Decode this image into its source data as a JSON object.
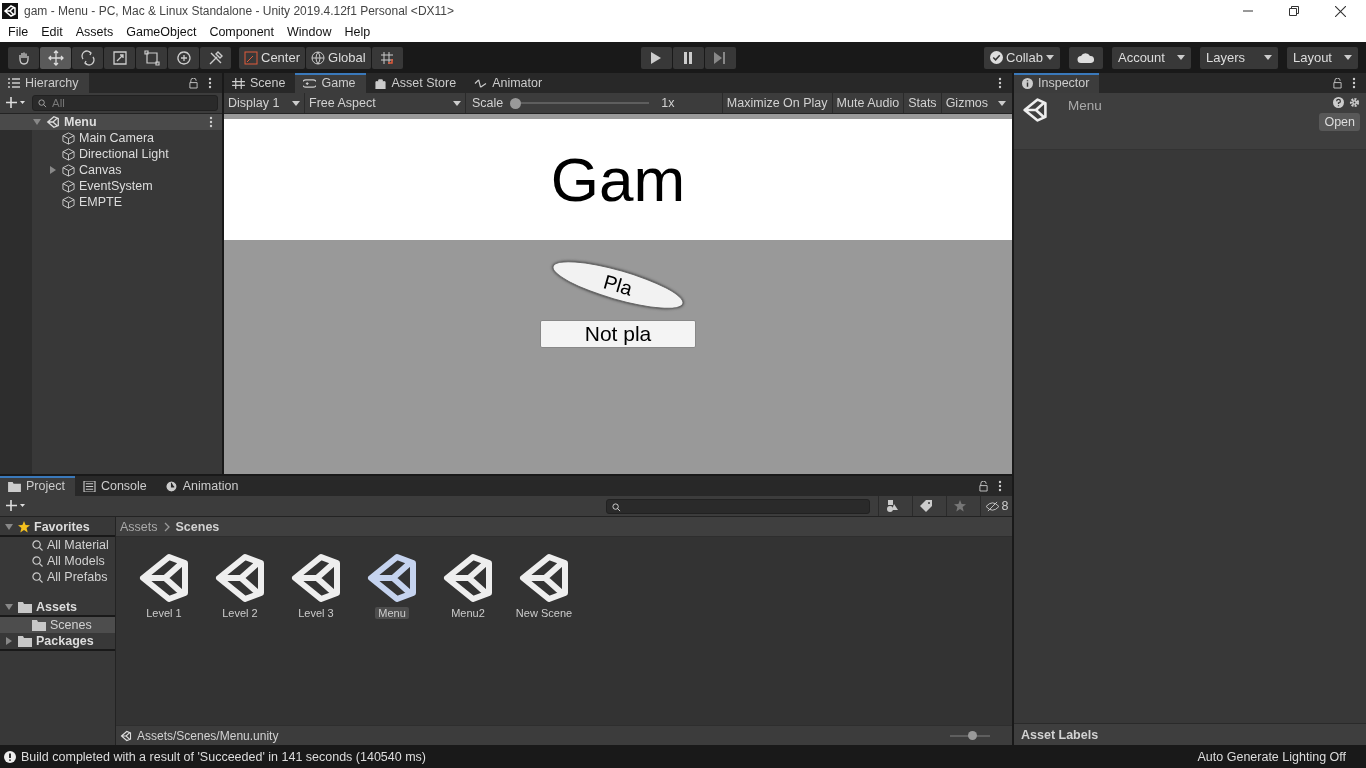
{
  "window": {
    "title": "gam - Menu - PC, Mac & Linux Standalone - Unity 2019.4.12f1 Personal <DX11>"
  },
  "menu": [
    "File",
    "Edit",
    "Assets",
    "GameObject",
    "Component",
    "Window",
    "Help"
  ],
  "toolbar": {
    "tools": [
      {
        "kind": "hand",
        "selected": false
      },
      {
        "kind": "move",
        "selected": true
      },
      {
        "kind": "rotate",
        "selected": false
      },
      {
        "kind": "scale",
        "selected": false
      },
      {
        "kind": "rect",
        "selected": false
      },
      {
        "kind": "transform",
        "selected": false
      },
      {
        "kind": "custom",
        "selected": false
      }
    ],
    "pivot": [
      "Center",
      "Global"
    ],
    "collab": "Collab",
    "account": "Account",
    "layers": "Layers",
    "layout": "Layout"
  },
  "hierarchy": {
    "tab": "Hierarchy",
    "search_placeholder": "All",
    "scenes": [
      {
        "name": "Menu",
        "expanded": true,
        "children": [
          {
            "name": "Main Camera",
            "has_children": false
          },
          {
            "name": "Directional Light",
            "has_children": false
          },
          {
            "name": "Canvas",
            "has_children": true
          },
          {
            "name": "EventSystem",
            "has_children": false
          },
          {
            "name": "EMPTE",
            "has_children": false
          }
        ]
      }
    ]
  },
  "center_tabs": [
    {
      "label": "Scene",
      "kind": "scene",
      "selected": false
    },
    {
      "label": "Game",
      "kind": "game",
      "selected": true
    },
    {
      "label": "Asset Store",
      "kind": "store",
      "selected": false
    },
    {
      "label": "Animator",
      "kind": "animator",
      "selected": false
    }
  ],
  "game_toolbar": {
    "display": "Display 1",
    "aspect": "Free Aspect",
    "scale_label": "Scale",
    "scale": {
      "level": 0.0
    },
    "scale_reading": "1x",
    "buttons": [
      "Maximize On Play",
      "Mute Audio",
      "Stats",
      "Gizmos"
    ]
  },
  "game_view": {
    "title": "Gam",
    "play_button": "Pla",
    "quit_button": "Not pla"
  },
  "inspector": {
    "tab": "Inspector",
    "asset": "Menu",
    "open_button": "Open",
    "asset_labels": "Asset Labels"
  },
  "bottom_tabs": [
    {
      "label": "Project",
      "kind": "project",
      "selected": true
    },
    {
      "label": "Console",
      "kind": "console",
      "selected": false
    },
    {
      "label": "Animation",
      "kind": "animation",
      "selected": false
    }
  ],
  "hidden_count": "8",
  "project_tree": [
    {
      "label": "Favorites",
      "kind": "favorites",
      "expanded": true,
      "selected": false,
      "children": [
        {
          "label": "All Material",
          "kind": "search",
          "selected": false
        },
        {
          "label": "All Models",
          "kind": "search",
          "selected": false
        },
        {
          "label": "All Prefabs",
          "kind": "search",
          "selected": false
        }
      ]
    },
    {
      "label": "Assets",
      "kind": "folder",
      "expanded": true,
      "selected": false,
      "children": [
        {
          "label": "Scenes",
          "kind": "folder",
          "selected": true
        }
      ]
    },
    {
      "label": "Packages",
      "kind": "folder",
      "expanded": false,
      "selected": false
    }
  ],
  "breadcrumb": [
    "Assets",
    "Scenes"
  ],
  "assets": [
    {
      "name": "Level 1",
      "selected": false
    },
    {
      "name": "Level 2",
      "selected": false
    },
    {
      "name": "Level 3",
      "selected": false
    },
    {
      "name": "Menu",
      "selected": true
    },
    {
      "name": "Menu2",
      "selected": false
    },
    {
      "name": "New Scene",
      "selected": false
    }
  ],
  "path": "Assets/Scenes/Menu.unity",
  "icon_size": {
    "level": 0.55
  },
  "status_bar": {
    "message": "Build completed with a result of 'Succeeded' in 141 seconds (140540 ms)",
    "lighting": "Auto Generate Lighting Off"
  }
}
